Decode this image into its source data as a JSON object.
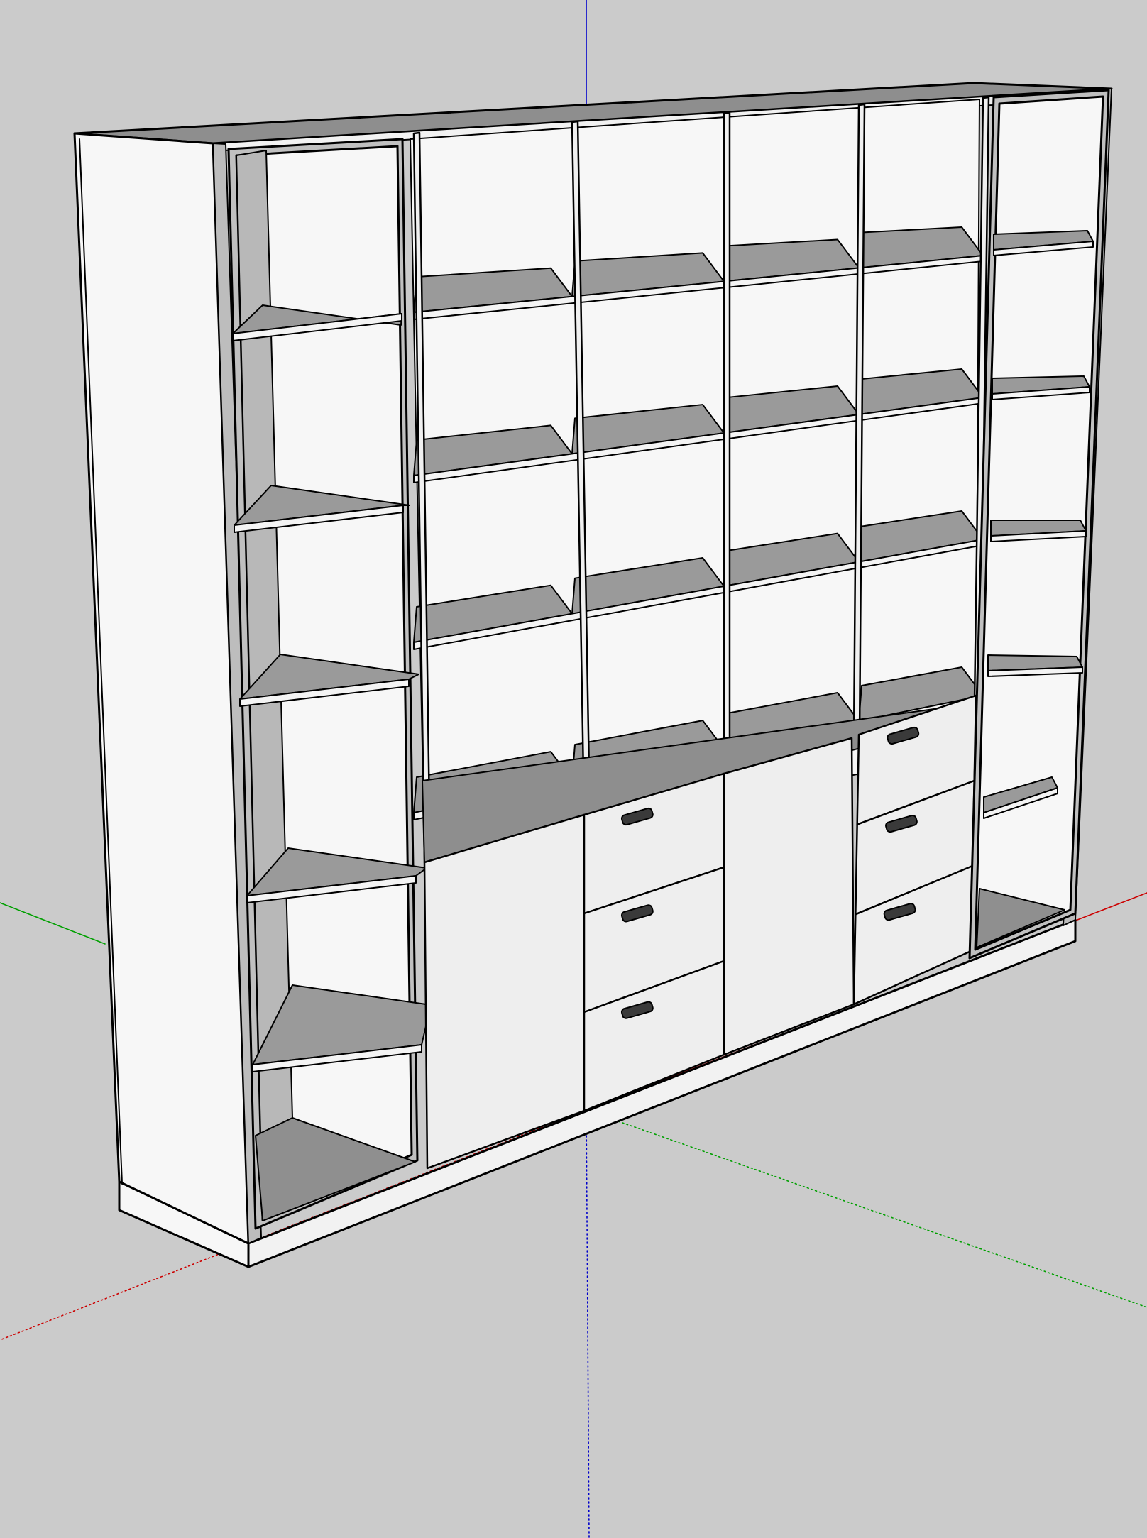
{
  "scene": {
    "background": "#cbcbcb",
    "axis_colors": {
      "red": "#cc0000",
      "green": "#00a000",
      "blue": "#0000cc"
    },
    "materials": {
      "panel_face": "#f7f7f7",
      "door_face": "#eeeeee",
      "shelf_top": "#9a9a9a",
      "side_inner": "#bcbcbc",
      "edge_stroke": "#000000"
    },
    "model": {
      "open_shelf_rows": 4,
      "middle_columns": 4,
      "left_tower_shelves": 5,
      "right_tower_shelves": 5,
      "drawer_stacks": 2,
      "drawers_per_stack": 3,
      "lower_doors": 2
    }
  }
}
